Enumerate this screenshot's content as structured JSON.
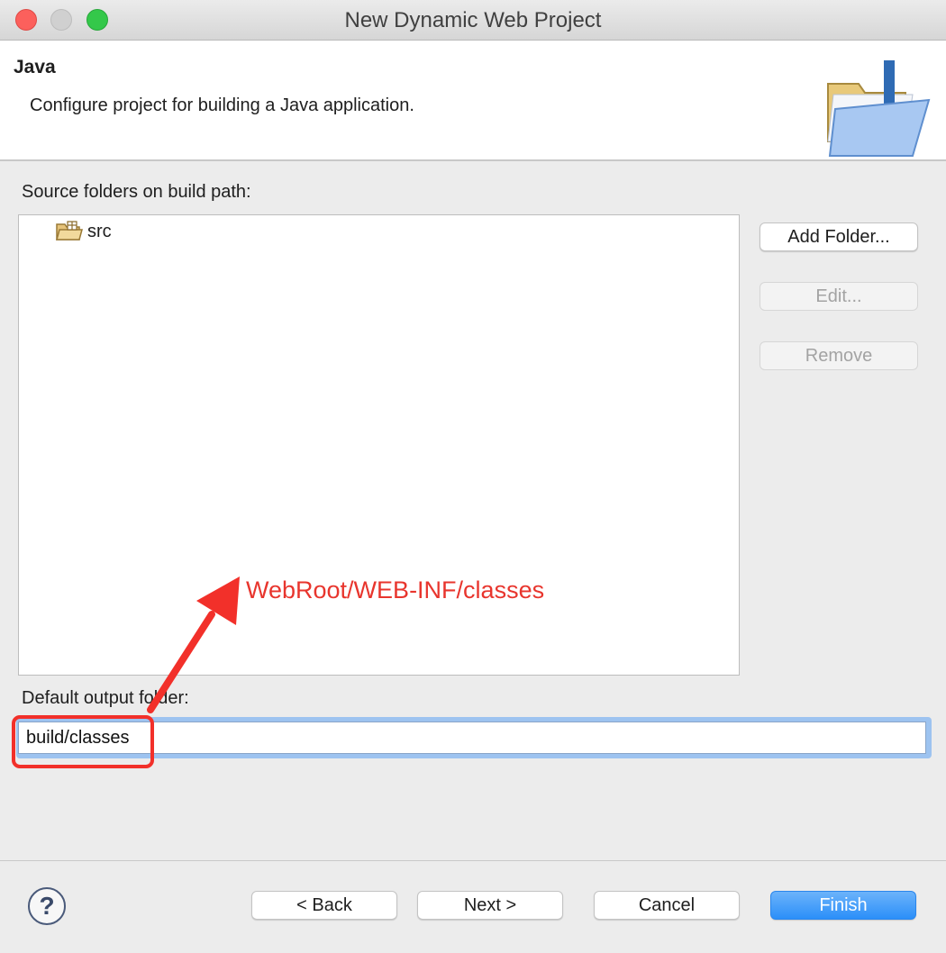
{
  "window": {
    "title": "New Dynamic Web Project"
  },
  "header": {
    "title": "Java",
    "description": "Configure project for building a Java application.",
    "icon": "java-folder-wizard-icon"
  },
  "source_folders": {
    "label": "Source folders on build path:",
    "items": [
      {
        "label": "src",
        "icon": "source-folder-icon"
      }
    ],
    "buttons": {
      "add": "Add Folder...",
      "edit": "Edit...",
      "remove": "Remove"
    }
  },
  "output_folder": {
    "label": "Default output folder:",
    "value": "build/classes"
  },
  "annotation": {
    "text": "WebRoot/WEB-INF/classes",
    "color": "#e8352d"
  },
  "footer": {
    "help": "?",
    "back": "< Back",
    "next": "Next >",
    "cancel": "Cancel",
    "finish": "Finish"
  },
  "colors": {
    "accent": "#2b8ff9",
    "focus_ring": "#9dc3f0"
  }
}
